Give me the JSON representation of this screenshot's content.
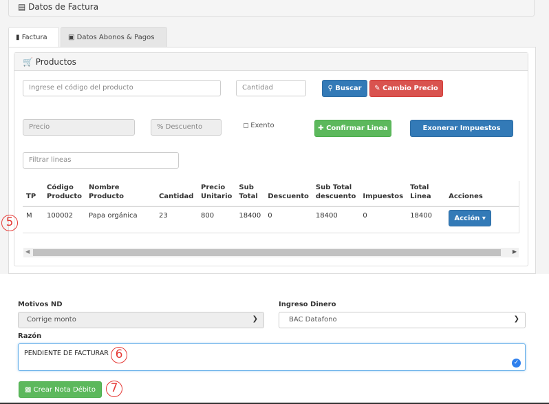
{
  "header": {
    "title": "Datos de Factura"
  },
  "tabs": [
    {
      "label": "Factura"
    },
    {
      "label": "Datos Abonos & Pagos"
    }
  ],
  "products": {
    "title": "Productos",
    "code_placeholder": "Ingrese el código del producto",
    "qty_placeholder": "Cantidad",
    "search_label": "Buscar",
    "change_price_label": "Cambio Precio",
    "price_placeholder": "Precio",
    "discount_placeholder": "% Descuento",
    "exempt_label": "Exento",
    "confirm_label": "Confirmar Linea",
    "exonerate_label": "Exonerar Impuestos",
    "filter_placeholder": "Filtrar lineas"
  },
  "table": {
    "headers": [
      "TP",
      "Código Producto",
      "Nombre Producto",
      "Cantidad",
      "Precio Unitario",
      "Sub Total",
      "Descuento",
      "Sub Total descuento",
      "Impuestos",
      "Total Linea",
      "Acciones"
    ],
    "rows": [
      {
        "tp": "M",
        "code": "100002",
        "name": "Papa orgánica",
        "qty": "23",
        "price": "800",
        "subtotal": "18400",
        "discount": "0",
        "subtotal_disc": "18400",
        "tax": "0",
        "total": "18400",
        "action": "Acción"
      }
    ]
  },
  "form": {
    "motivos_label": "Motivos ND",
    "motivos_value": "Corrige monto",
    "ingreso_label": "Ingreso Dinero",
    "ingreso_value": "BAC Datafono",
    "razon_label": "Razón",
    "razon_value": "PENDIENTE DE FACTURAR",
    "create_label": "Crear Nota Débito"
  },
  "annotations": [
    "5",
    "6",
    "7"
  ],
  "colors": {
    "primary": "#337ab7",
    "danger": "#d9534f",
    "success": "#5cb85c",
    "annotation": "#e53935"
  }
}
